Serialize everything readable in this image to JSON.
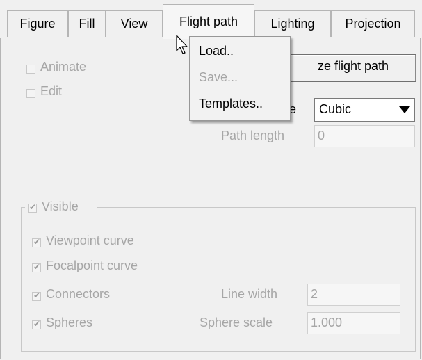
{
  "tabs": [
    {
      "label": "Figure"
    },
    {
      "label": "Fill"
    },
    {
      "label": "View"
    },
    {
      "label": "Flight path"
    },
    {
      "label": "Lighting"
    },
    {
      "label": "Projection"
    }
  ],
  "active_tab": "Flight path",
  "left_options": {
    "animate_label": "Animate",
    "edit_label": "Edit"
  },
  "buttons": {
    "optimize_label": "ze flight path"
  },
  "interpolation": {
    "label": "le",
    "value": "Cubic"
  },
  "path_length": {
    "label": "Path length",
    "value": "0"
  },
  "visibility_group": {
    "title": "Visible",
    "viewpoint_curve": "Viewpoint curve",
    "focalpoint_curve": "Focalpoint curve",
    "connectors": "Connectors",
    "spheres": "Spheres",
    "line_width_label": "Line width",
    "line_width_value": "2",
    "sphere_scale_label": "Sphere scale",
    "sphere_scale_value": "1.000"
  },
  "menu": {
    "items": [
      {
        "label": "Load..",
        "enabled": true
      },
      {
        "label": "Save...",
        "enabled": false
      },
      {
        "label": "Templates..",
        "enabled": true
      }
    ]
  }
}
